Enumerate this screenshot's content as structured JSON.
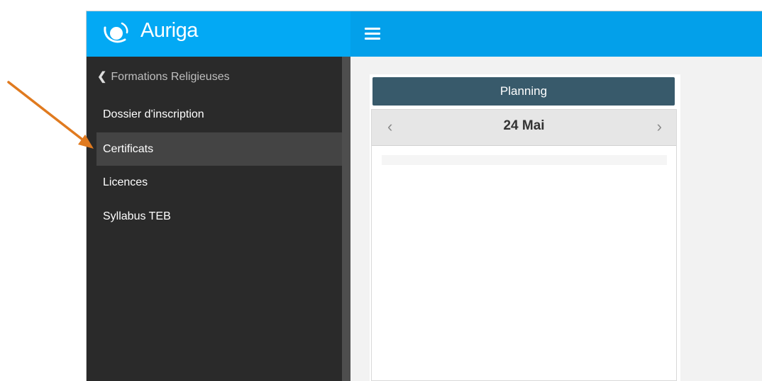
{
  "brand": {
    "name": "Auriga",
    "logo_icon": "auriga-logo-icon"
  },
  "topbar": {
    "menu_icon": "hamburger-menu-icon"
  },
  "sidebar": {
    "back": {
      "icon": "chevron-left-icon",
      "label": "Formations Religieuses"
    },
    "items": [
      {
        "label": "Dossier d'inscription",
        "active": false
      },
      {
        "label": "Certificats",
        "active": true
      },
      {
        "label": "Licences",
        "active": false
      },
      {
        "label": "Syllabus TEB",
        "active": false
      }
    ]
  },
  "main": {
    "planning": {
      "title": "Planning",
      "date": "24 Mai",
      "prev_icon": "chevron-left-icon",
      "next_icon": "chevron-right-icon"
    }
  },
  "annotation": {
    "icon": "pointer-arrow-icon",
    "color": "#e07a1f"
  },
  "colors": {
    "brand_blue": "#03a9f4",
    "sidebar_bg": "#2a2a2a",
    "planning_header": "#385a6b"
  }
}
